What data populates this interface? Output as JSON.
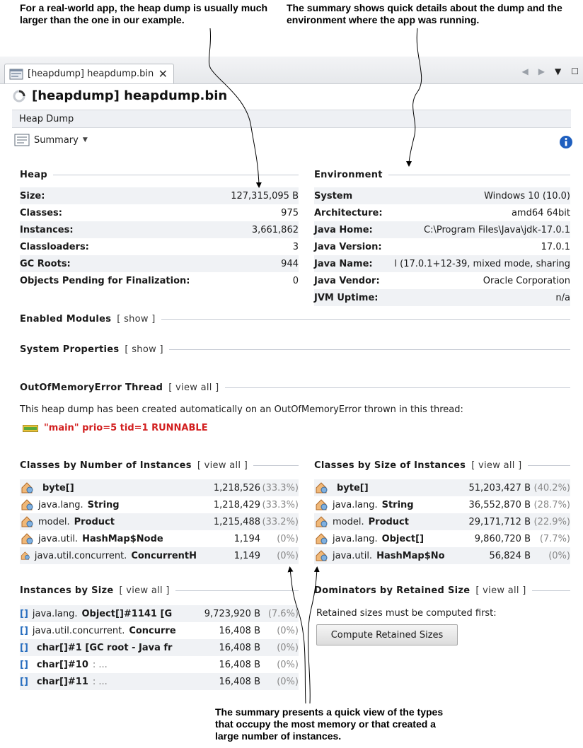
{
  "callouts": {
    "left": "For a real-world app, the heap dump is usually much larger than the one in our example.",
    "right": "The summary shows quick details about the dump and the environment where the app was running.",
    "bottom": "The summary presents a quick view of the types that occupy the most memory or that created a large number of instances."
  },
  "tab": {
    "label": "[heapdump] heapdump.bin",
    "close": "✕"
  },
  "title": "[heapdump] heapdump.bin",
  "subtab": "Heap Dump",
  "view_select": "Summary",
  "heap": {
    "heading": "Heap",
    "rows": [
      {
        "k": "Size:",
        "v": "127,315,095 B"
      },
      {
        "k": "Classes:",
        "v": "975"
      },
      {
        "k": "Instances:",
        "v": "3,661,862"
      },
      {
        "k": "Classloaders:",
        "v": "3"
      },
      {
        "k": "GC Roots:",
        "v": "944"
      },
      {
        "k": "Objects Pending for Finalization:",
        "v": "0"
      }
    ]
  },
  "environment": {
    "heading": "Environment",
    "rows": [
      {
        "k": "System",
        "v": "Windows 10 (10.0)"
      },
      {
        "k": "Architecture:",
        "v": "amd64 64bit"
      },
      {
        "k": "Java Home:",
        "v": "C:\\Program Files\\Java\\jdk-17.0.1"
      },
      {
        "k": "Java Version:",
        "v": "17.0.1"
      },
      {
        "k": "Java Name:",
        "v": "l (17.0.1+12-39, mixed mode, sharing"
      },
      {
        "k": "Java Vendor:",
        "v": "Oracle Corporation"
      },
      {
        "k": "JVM Uptime:",
        "v": "n/a"
      }
    ]
  },
  "modules": {
    "heading": "Enabled Modules",
    "link": "[ show ]"
  },
  "sysprops": {
    "heading": "System Properties",
    "link": "[ show ]"
  },
  "oom": {
    "heading": "OutOfMemoryError Thread",
    "link": "[ view all ]",
    "message": "This heap dump has been created automatically on an OutOfMemoryError thrown in this thread:",
    "thread": "\"main\" prio=5 tid=1 RUNNABLE"
  },
  "by_count": {
    "heading": "Classes by Number of Instances",
    "link": "[ view all ]",
    "rows": [
      {
        "pre": "",
        "bold": "byte[]",
        "num": "1,218,526",
        "pct": "(33.3%)"
      },
      {
        "pre": "java.lang.",
        "bold": "String",
        "num": "1,218,429",
        "pct": "(33.3%)"
      },
      {
        "pre": "model.",
        "bold": "Product",
        "num": "1,215,488",
        "pct": "(33.2%)"
      },
      {
        "pre": "java.util.",
        "bold": "HashMap$Node",
        "num": "1,194",
        "pct": "(0%)"
      },
      {
        "pre": "java.util.concurrent.",
        "bold": "ConcurrentH",
        "num": "1,149",
        "pct": "(0%)"
      }
    ]
  },
  "by_size": {
    "heading": "Classes by Size of Instances",
    "link": "[ view all ]",
    "rows": [
      {
        "pre": "",
        "bold": "byte[]",
        "num": "51,203,427 B",
        "pct": "(40.2%)"
      },
      {
        "pre": "java.lang.",
        "bold": "String",
        "num": "36,552,870 B",
        "pct": "(28.7%)"
      },
      {
        "pre": "model.",
        "bold": "Product",
        "num": "29,171,712 B",
        "pct": "(22.9%)"
      },
      {
        "pre": "java.lang.",
        "bold": "Object[]",
        "num": "9,860,720 B",
        "pct": "(7.7%)"
      },
      {
        "pre": "java.util.",
        "bold": "HashMap$No",
        "num": "56,824 B",
        "pct": "(0%)"
      }
    ]
  },
  "inst_size": {
    "heading": "Instances by Size",
    "link": "[ view all ]",
    "rows": [
      {
        "pre": "java.lang.",
        "bold": "Object[]#1141 [G",
        "num": "9,723,920 B",
        "pct": "(7.6%)"
      },
      {
        "pre": "java.util.concurrent.",
        "bold": "Concurre",
        "num": "16,408 B",
        "pct": "(0%)"
      },
      {
        "pre": "",
        "bold": "char[]#1 [GC root - Java fr",
        "num": "16,408 B",
        "pct": "(0%)"
      },
      {
        "pre": "",
        "bold": "char[]#10",
        "post": " : ...",
        "num": "16,408 B",
        "pct": "(0%)"
      },
      {
        "pre": "",
        "bold": "char[]#11",
        "post": " : ...",
        "num": "16,408 B",
        "pct": "(0%)"
      }
    ]
  },
  "dominators": {
    "heading": "Dominators by Retained Size",
    "link": "[ view all ]",
    "message": "Retained sizes must be computed first:",
    "button": "Compute Retained Sizes"
  }
}
